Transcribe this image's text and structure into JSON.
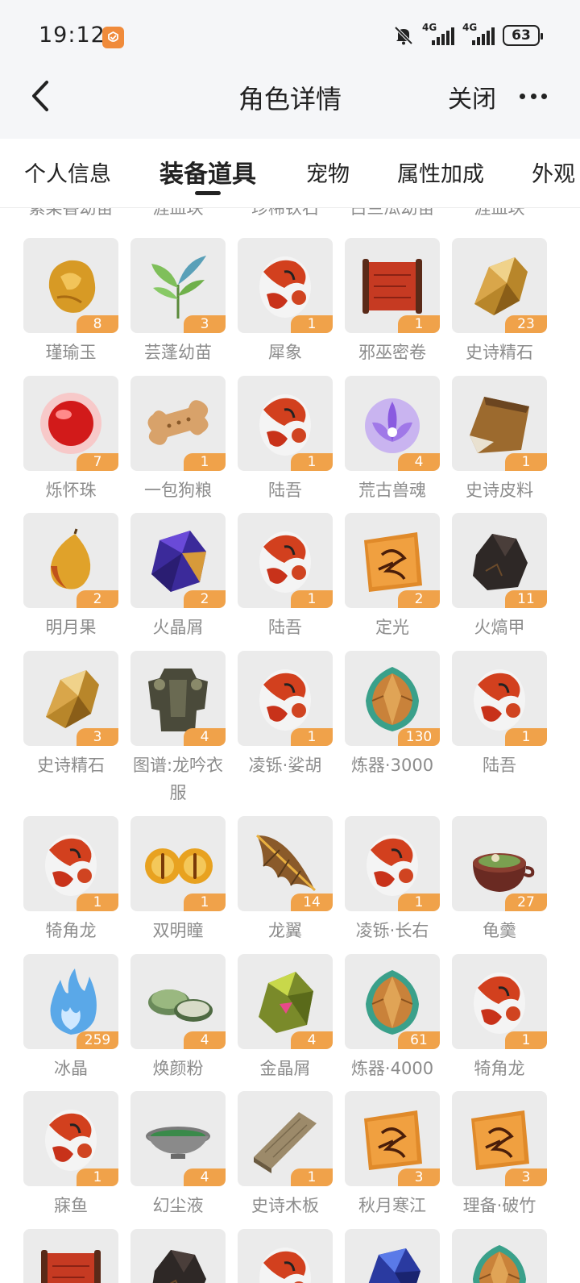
{
  "status_bar": {
    "time": "19:12",
    "network1": "4G",
    "network2": "4G",
    "battery": "63"
  },
  "nav": {
    "title": "角色详情",
    "close_label": "关闭"
  },
  "tabs": [
    {
      "label": "个人信息",
      "active": false
    },
    {
      "label": "装备道具",
      "active": true
    },
    {
      "label": "宠物",
      "active": false
    },
    {
      "label": "属性加成",
      "active": false
    },
    {
      "label": "外观",
      "active": false
    }
  ],
  "cut_row_labels": [
    "紫染香幼苗",
    "涯血玦",
    "珍稀铁石",
    "白兰瓜幼苗",
    "涯血玦"
  ],
  "items": [
    {
      "name": "瑾瑜玉",
      "count": "8",
      "icon": "amber-jade-icon"
    },
    {
      "name": "芸蓬幼苗",
      "count": "3",
      "icon": "herb-sprout-icon"
    },
    {
      "name": "犀象",
      "count": "1",
      "icon": "beast-egg-icon"
    },
    {
      "name": "邪巫密卷",
      "count": "1",
      "icon": "scroll-icon"
    },
    {
      "name": "史诗精石",
      "count": "23",
      "icon": "gold-ore-icon"
    },
    {
      "name": "烁怀珠",
      "count": "7",
      "icon": "red-orb-icon"
    },
    {
      "name": "一包狗粮",
      "count": "1",
      "icon": "dog-bone-icon"
    },
    {
      "name": "陆吾",
      "count": "1",
      "icon": "beast-egg-icon"
    },
    {
      "name": "荒古兽魂",
      "count": "4",
      "icon": "spirit-flower-icon"
    },
    {
      "name": "史诗皮料",
      "count": "1",
      "icon": "leather-icon"
    },
    {
      "name": "明月果",
      "count": "2",
      "icon": "fig-fruit-icon"
    },
    {
      "name": "火晶屑",
      "count": "2",
      "icon": "purple-crystal-icon"
    },
    {
      "name": "陆吾",
      "count": "1",
      "icon": "beast-egg-icon"
    },
    {
      "name": "定光",
      "count": "2",
      "icon": "rune-card-icon"
    },
    {
      "name": "火熇甲",
      "count": "11",
      "icon": "dark-stone-icon"
    },
    {
      "name": "史诗精石",
      "count": "3",
      "icon": "gold-ore-icon"
    },
    {
      "name": "图谱:龙吟衣服",
      "count": "4",
      "icon": "armor-icon"
    },
    {
      "name": "凌铄·娑胡",
      "count": "1",
      "icon": "beast-egg-icon"
    },
    {
      "name": "炼器·3000",
      "count": "130",
      "icon": "refine-gem-icon"
    },
    {
      "name": "陆吾",
      "count": "1",
      "icon": "beast-egg-icon"
    },
    {
      "name": "犄角龙",
      "count": "1",
      "icon": "beast-egg-icon"
    },
    {
      "name": "双明瞳",
      "count": "1",
      "icon": "twin-eyes-icon"
    },
    {
      "name": "龙翼",
      "count": "14",
      "icon": "dragon-wing-icon"
    },
    {
      "name": "凌铄·长右",
      "count": "1",
      "icon": "beast-egg-icon"
    },
    {
      "name": "龟羹",
      "count": "27",
      "icon": "soup-pot-icon"
    },
    {
      "name": "冰晶",
      "count": "259",
      "icon": "blue-flame-icon"
    },
    {
      "name": "焕颜粉",
      "count": "4",
      "icon": "powder-box-icon"
    },
    {
      "name": "金晶屑",
      "count": "4",
      "icon": "green-crystal-icon"
    },
    {
      "name": "炼器·4000",
      "count": "61",
      "icon": "refine-gem-icon"
    },
    {
      "name": "犄角龙",
      "count": "1",
      "icon": "beast-egg-icon"
    },
    {
      "name": "寐鱼",
      "count": "1",
      "icon": "beast-egg-icon"
    },
    {
      "name": "幻尘液",
      "count": "4",
      "icon": "liquid-bowl-icon"
    },
    {
      "name": "史诗木板",
      "count": "1",
      "icon": "wood-plank-icon"
    },
    {
      "name": "秋月寒江",
      "count": "3",
      "icon": "rune-card-icon"
    },
    {
      "name": "理备·破竹",
      "count": "3",
      "icon": "rune-card-icon"
    },
    {
      "name": "",
      "count": "",
      "icon": "scroll-icon"
    },
    {
      "name": "",
      "count": "",
      "icon": "dark-stone-icon"
    },
    {
      "name": "",
      "count": "",
      "icon": "beast-egg-icon"
    },
    {
      "name": "",
      "count": "",
      "icon": "blue-crystal-icon"
    },
    {
      "name": "",
      "count": "",
      "icon": "refine-gem-icon"
    }
  ]
}
